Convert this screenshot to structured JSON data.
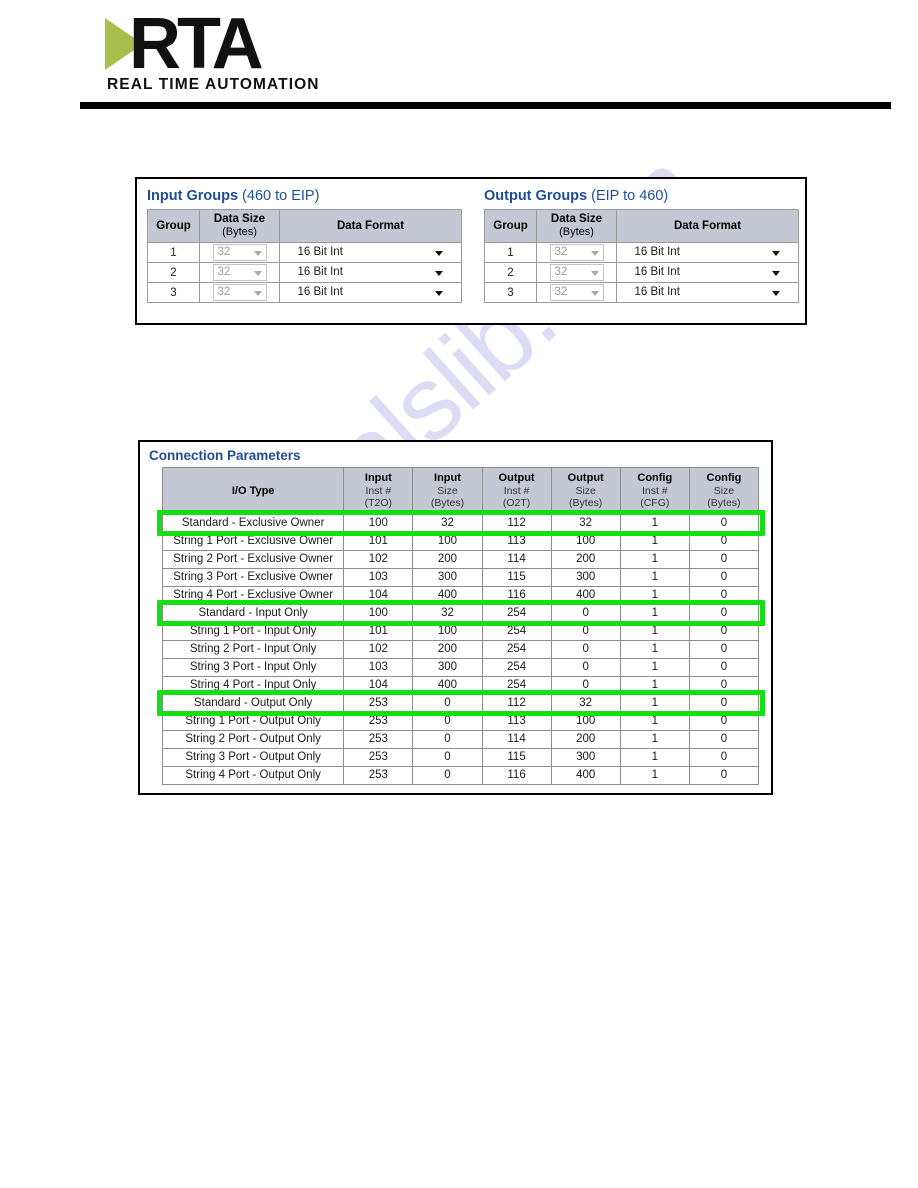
{
  "brand": {
    "logo_text": "RTA",
    "logo_tagline": "REAL TIME AUTOMATION",
    "logo_green": "#a8bf4d",
    "accent_blue": "#1f4e99",
    "highlight_green": "#12e012"
  },
  "watermark": {
    "text": "manualslib.com"
  },
  "groups_panel": {
    "input": {
      "title_bold": "Input Groups",
      "title_light": "(460 to EIP)",
      "columns": [
        "Group",
        "Data Size",
        "Data Format"
      ],
      "col_size_sub": "(Bytes)",
      "rows": [
        {
          "group": "1",
          "data_size": "32",
          "data_format": "16 Bit Int"
        },
        {
          "group": "2",
          "data_size": "32",
          "data_format": "16 Bit Int"
        },
        {
          "group": "3",
          "data_size": "32",
          "data_format": "16 Bit Int"
        }
      ]
    },
    "output": {
      "title_bold": "Output Groups",
      "title_light": "(EIP to 460)",
      "columns": [
        "Group",
        "Data Size",
        "Data Format"
      ],
      "col_size_sub": "(Bytes)",
      "rows": [
        {
          "group": "1",
          "data_size": "32",
          "data_format": "16 Bit Int"
        },
        {
          "group": "2",
          "data_size": "32",
          "data_format": "16 Bit Int"
        },
        {
          "group": "3",
          "data_size": "32",
          "data_format": "16 Bit Int"
        }
      ]
    }
  },
  "connection_parameters": {
    "title": "Connection Parameters",
    "headers": [
      {
        "main": "I/O Type",
        "sub2": "",
        "sub3": ""
      },
      {
        "main": "Input",
        "sub2": "Inst #",
        "sub3": "(T2O)"
      },
      {
        "main": "Input",
        "sub2": "Size",
        "sub3": "(Bytes)"
      },
      {
        "main": "Output",
        "sub2": "Inst #",
        "sub3": "(O2T)"
      },
      {
        "main": "Output",
        "sub2": "Size",
        "sub3": "(Bytes)"
      },
      {
        "main": "Config",
        "sub2": "Inst #",
        "sub3": "(CFG)"
      },
      {
        "main": "Config",
        "sub2": "Size",
        "sub3": "(Bytes)"
      }
    ],
    "rows": [
      {
        "io_type": "Standard - Exclusive Owner",
        "input_inst": "100",
        "input_size": "32",
        "output_inst": "112",
        "output_size": "32",
        "config_inst": "1",
        "config_size": "0",
        "highlighted": true
      },
      {
        "io_type": "String 1 Port - Exclusive Owner",
        "input_inst": "101",
        "input_size": "100",
        "output_inst": "113",
        "output_size": "100",
        "config_inst": "1",
        "config_size": "0",
        "highlighted": false
      },
      {
        "io_type": "String 2 Port - Exclusive Owner",
        "input_inst": "102",
        "input_size": "200",
        "output_inst": "114",
        "output_size": "200",
        "config_inst": "1",
        "config_size": "0",
        "highlighted": false
      },
      {
        "io_type": "String 3 Port - Exclusive Owner",
        "input_inst": "103",
        "input_size": "300",
        "output_inst": "115",
        "output_size": "300",
        "config_inst": "1",
        "config_size": "0",
        "highlighted": false
      },
      {
        "io_type": "String 4 Port - Exclusive Owner",
        "input_inst": "104",
        "input_size": "400",
        "output_inst": "116",
        "output_size": "400",
        "config_inst": "1",
        "config_size": "0",
        "highlighted": false
      },
      {
        "io_type": "Standard - Input Only",
        "input_inst": "100",
        "input_size": "32",
        "output_inst": "254",
        "output_size": "0",
        "config_inst": "1",
        "config_size": "0",
        "highlighted": true
      },
      {
        "io_type": "String 1 Port - Input Only",
        "input_inst": "101",
        "input_size": "100",
        "output_inst": "254",
        "output_size": "0",
        "config_inst": "1",
        "config_size": "0",
        "highlighted": false
      },
      {
        "io_type": "String 2 Port - Input Only",
        "input_inst": "102",
        "input_size": "200",
        "output_inst": "254",
        "output_size": "0",
        "config_inst": "1",
        "config_size": "0",
        "highlighted": false
      },
      {
        "io_type": "String 3 Port - Input Only",
        "input_inst": "103",
        "input_size": "300",
        "output_inst": "254",
        "output_size": "0",
        "config_inst": "1",
        "config_size": "0",
        "highlighted": false
      },
      {
        "io_type": "String 4 Port - Input Only",
        "input_inst": "104",
        "input_size": "400",
        "output_inst": "254",
        "output_size": "0",
        "config_inst": "1",
        "config_size": "0",
        "highlighted": false
      },
      {
        "io_type": "Standard - Output Only",
        "input_inst": "253",
        "input_size": "0",
        "output_inst": "112",
        "output_size": "32",
        "config_inst": "1",
        "config_size": "0",
        "highlighted": true
      },
      {
        "io_type": "String 1 Port - Output Only",
        "input_inst": "253",
        "input_size": "0",
        "output_inst": "113",
        "output_size": "100",
        "config_inst": "1",
        "config_size": "0",
        "highlighted": false
      },
      {
        "io_type": "String 2 Port - Output Only",
        "input_inst": "253",
        "input_size": "0",
        "output_inst": "114",
        "output_size": "200",
        "config_inst": "1",
        "config_size": "0",
        "highlighted": false
      },
      {
        "io_type": "String 3 Port - Output Only",
        "input_inst": "253",
        "input_size": "0",
        "output_inst": "115",
        "output_size": "300",
        "config_inst": "1",
        "config_size": "0",
        "highlighted": false
      },
      {
        "io_type": "String 4 Port - Output Only",
        "input_inst": "253",
        "input_size": "0",
        "output_inst": "116",
        "output_size": "400",
        "config_inst": "1",
        "config_size": "0",
        "highlighted": false
      }
    ]
  }
}
